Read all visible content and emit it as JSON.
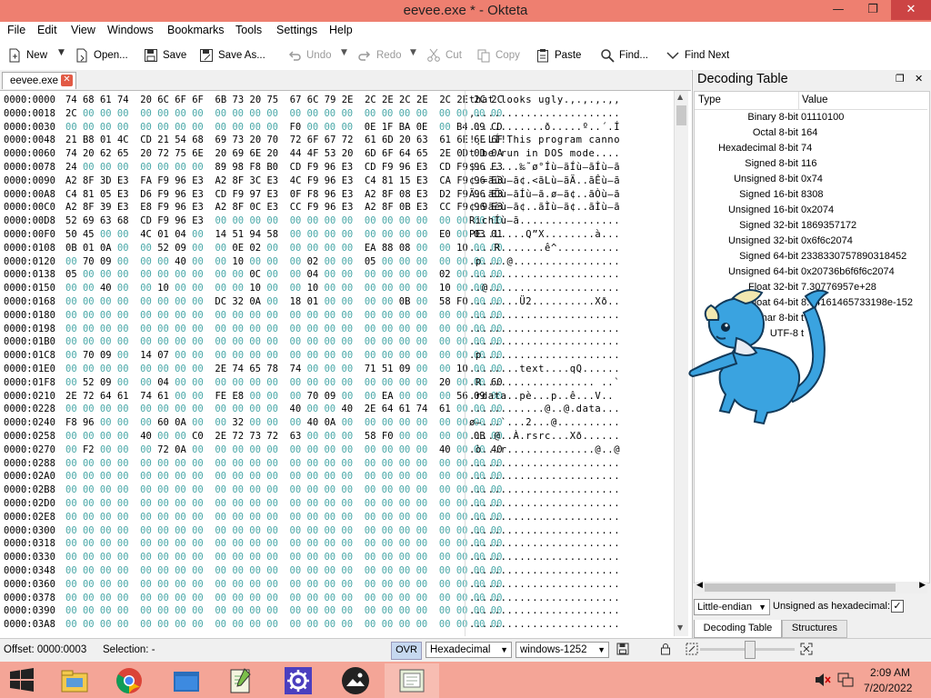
{
  "window": {
    "title": "eevee.exe * - Okteta"
  },
  "menu": [
    "File",
    "Edit",
    "View",
    "Windows",
    "Bookmarks",
    "Tools",
    "Settings",
    "Help"
  ],
  "toolbar": {
    "new": "New",
    "open": "Open...",
    "save": "Save",
    "save_as": "Save As...",
    "undo": "Undo",
    "redo": "Redo",
    "cut": "Cut",
    "copy": "Copy",
    "paste": "Paste",
    "find": "Find...",
    "find_next": "Find Next"
  },
  "tab": {
    "file": "eevee.exe"
  },
  "hex_rows": [
    {
      "o": "0000:0000",
      "h": "74 68 61 74  20 6C 6F 6F  6B 73 20 75  67 6C 79 2E  2C 2E 2C 2E  2C 2E 2C 2C",
      "c": "that looks ugly.,.,.,.,,"
    },
    {
      "o": "0000:0018",
      "h": "2C 00 00 00  00 00 00 00  00 00 00 00  00 00 00 00  00 00 00 00  00 00 00 00",
      "c": ",......................."
    },
    {
      "o": "0000:0030",
      "h": "00 00 00 00  00 00 00 00  00 00 00 00  F0 00 00 00  0E 1F BA 0E  00 B4 09 CD",
      "c": "............ð.....º..´.Í"
    },
    {
      "o": "0000:0048",
      "h": "21 B8 01 4C  CD 21 54 68  69 73 20 70  72 6F 67 72  61 6D 20 63  61 6E 6E 6F",
      "c": "!¸.LÍ!This program canno"
    },
    {
      "o": "0000:0060",
      "h": "74 20 62 65  20 72 75 6E  20 69 6E 20  44 4F 53 20  6D 6F 64 65  2E 0D 0D 0A",
      "c": "t be run in DOS mode...."
    },
    {
      "o": "0000:0078",
      "h": "24 00 00 00  00 00 00 00  89 98 F8 B0  CD F9 96 E3  CD F9 96 E3  CD F9 96 E3",
      "c": "$.......‰˜ø°Íù–ãÍù–ãÍù–ã"
    },
    {
      "o": "0000:0090",
      "h": "A2 8F 3D E3  FA F9 96 E3  A2 8F 3C E3  4C F9 96 E3  C4 81 15 E3  CA F9 96 E3",
      "c": "¢.=ãúù–ã¢.<ãLù–ãÄ..ãÊù–ã"
    },
    {
      "o": "0000:00A8",
      "h": "C4 81 05 E3  D6 F9 96 E3  CD F9 97 E3  0F F8 96 E3  A2 8F 08 E3  D2 F9 96 E3",
      "c": "Ä..ãÖù–ãÍù—ã.ø–ã¢..ãÒù–ã"
    },
    {
      "o": "0000:00C0",
      "h": "A2 8F 39 E3  E8 F9 96 E3  A2 8F 0C E3  CC F9 96 E3  A2 8F 0B E3  CC F9 96 E3",
      "c": "¢.9ãèù–ã¢..ãÌù–ã¢..ãÌù–ã"
    },
    {
      "o": "0000:00D8",
      "h": "52 69 63 68  CD F9 96 E3  00 00 00 00  00 00 00 00  00 00 00 00  00 00 00 00",
      "c": "RichÍù–ã................"
    },
    {
      "o": "0000:00F0",
      "h": "50 45 00 00  4C 01 04 00  14 51 94 58  00 00 00 00  00 00 00 00  E0 00 03 01",
      "c": "PE..L....Q”X........à..."
    },
    {
      "o": "0000:0108",
      "h": "0B 01 0A 00  00 52 09 00  00 0E 02 00  00 00 00 00  EA 88 08 00  00 10 00 00",
      "c": "....R.......ê^.........."
    },
    {
      "o": "0000:0120",
      "h": "00 70 09 00  00 00 40 00  00 10 00 00  00 02 00 00  05 00 00 00  00 00 00 00",
      "c": ".p....@................."
    },
    {
      "o": "0000:0138",
      "h": "05 00 00 00  00 00 00 00  00 00 0C 00  00 04 00 00  00 00 00 00  02 00 00 00",
      "c": "........................"
    },
    {
      "o": "0000:0150",
      "h": "00 00 40 00  00 10 00 00  00 00 10 00  00 10 00 00  00 00 00 00  10 00 00 00",
      "c": "..@....................."
    },
    {
      "o": "0000:0168",
      "h": "00 00 00 00  00 00 00 00  DC 32 0A 00  18 01 00 00  00 00 0B 00  58 F0 00 00",
      "c": "........Ü2..........Xð.."
    },
    {
      "o": "0000:0180",
      "h": "00 00 00 00  00 00 00 00  00 00 00 00  00 00 00 00  00 00 00 00  00 00 00 00",
      "c": "........................"
    },
    {
      "o": "0000:0198",
      "h": "00 00 00 00  00 00 00 00  00 00 00 00  00 00 00 00  00 00 00 00  00 00 00 00",
      "c": "........................"
    },
    {
      "o": "0000:01B0",
      "h": "00 00 00 00  00 00 00 00  00 00 00 00  00 00 00 00  00 00 00 00  00 00 00 00",
      "c": "........................"
    },
    {
      "o": "0000:01C8",
      "h": "00 70 09 00  14 07 00 00  00 00 00 00  00 00 00 00  00 00 00 00  00 00 00 00",
      "c": ".p......................"
    },
    {
      "o": "0000:01E0",
      "h": "00 00 00 00  00 00 00 00  2E 74 65 78  74 00 00 00  71 51 09 00  00 10 00 00",
      "c": "........text....qQ......"
    },
    {
      "o": "0000:01F8",
      "h": "00 52 09 00  00 04 00 00  00 00 00 00  00 00 00 00  00 00 00 00  20 00 00 60",
      "c": ".R.................. ..`"
    },
    {
      "o": "0000:0210",
      "h": "2E 72 64 61  74 61 00 00  FE E8 00 00  00 70 09 00  00 EA 00 00  00 56 09 00",
      "c": ".rdata..pè...p..ê...V.."
    },
    {
      "o": "0000:0228",
      "h": "00 00 00 00  00 00 00 00  00 00 00 00  40 00 00 40  2E 64 61 74  61 00 00 00",
      "c": "............@..@.data..."
    },
    {
      "o": "0000:0240",
      "h": "F8 96 00 00  00 60 0A 00  00 32 00 00  00 40 0A 00  00 00 00 00  00 00 00 00",
      "c": "ø–...`...2...@.........."
    },
    {
      "o": "0000:0258",
      "h": "00 00 00 00  40 00 00 C0  2E 72 73 72  63 00 00 00  58 F0 00 00  00 00 0B 00",
      "c": "....@..À.rsrc...Xð......"
    },
    {
      "o": "0000:0270",
      "h": "00 F2 00 00  00 72 0A 00  00 00 00 00  00 00 00 00  00 00 00 00  40 00 00 40",
      "c": ".ò...r..............@..@"
    },
    {
      "o": "0000:0288",
      "h": "00 00 00 00  00 00 00 00  00 00 00 00  00 00 00 00  00 00 00 00  00 00 00 00",
      "c": "........................"
    },
    {
      "o": "0000:02A0",
      "h": "00 00 00 00  00 00 00 00  00 00 00 00  00 00 00 00  00 00 00 00  00 00 00 00",
      "c": "........................"
    },
    {
      "o": "0000:02B8",
      "h": "00 00 00 00  00 00 00 00  00 00 00 00  00 00 00 00  00 00 00 00  00 00 00 00",
      "c": "........................"
    },
    {
      "o": "0000:02D0",
      "h": "00 00 00 00  00 00 00 00  00 00 00 00  00 00 00 00  00 00 00 00  00 00 00 00",
      "c": "........................"
    },
    {
      "o": "0000:02E8",
      "h": "00 00 00 00  00 00 00 00  00 00 00 00  00 00 00 00  00 00 00 00  00 00 00 00",
      "c": "........................"
    },
    {
      "o": "0000:0300",
      "h": "00 00 00 00  00 00 00 00  00 00 00 00  00 00 00 00  00 00 00 00  00 00 00 00",
      "c": "........................"
    },
    {
      "o": "0000:0318",
      "h": "00 00 00 00  00 00 00 00  00 00 00 00  00 00 00 00  00 00 00 00  00 00 00 00",
      "c": "........................"
    },
    {
      "o": "0000:0330",
      "h": "00 00 00 00  00 00 00 00  00 00 00 00  00 00 00 00  00 00 00 00  00 00 00 00",
      "c": "........................"
    },
    {
      "o": "0000:0348",
      "h": "00 00 00 00  00 00 00 00  00 00 00 00  00 00 00 00  00 00 00 00  00 00 00 00",
      "c": "........................"
    },
    {
      "o": "0000:0360",
      "h": "00 00 00 00  00 00 00 00  00 00 00 00  00 00 00 00  00 00 00 00  00 00 00 00",
      "c": "........................"
    },
    {
      "o": "0000:0378",
      "h": "00 00 00 00  00 00 00 00  00 00 00 00  00 00 00 00  00 00 00 00  00 00 00 00",
      "c": "........................"
    },
    {
      "o": "0000:0390",
      "h": "00 00 00 00  00 00 00 00  00 00 00 00  00 00 00 00  00 00 00 00  00 00 00 00",
      "c": "........................"
    },
    {
      "o": "0000:03A8",
      "h": "00 00 00 00  00 00 00 00  00 00 00 00  00 00 00 00  00 00 00 00  00 00 00 00",
      "c": "........................"
    }
  ],
  "decoding": {
    "title": "Decoding Table",
    "col_type": "Type",
    "col_value": "Value",
    "rows": [
      {
        "type": "Binary 8-bit",
        "value": "01110100"
      },
      {
        "type": "Octal 8-bit",
        "value": "164"
      },
      {
        "type": "Hexadecimal 8-bit",
        "value": "74"
      },
      {
        "type": "Signed 8-bit",
        "value": "116"
      },
      {
        "type": "Unsigned 8-bit",
        "value": "0x74"
      },
      {
        "type": "Signed 16-bit",
        "value": "8308"
      },
      {
        "type": "Unsigned 16-bit",
        "value": "0x2074"
      },
      {
        "type": "Signed 32-bit",
        "value": "1869357172"
      },
      {
        "type": "Unsigned 32-bit",
        "value": "0x6f6c2074"
      },
      {
        "type": "Signed 64-bit",
        "value": "2338330757890318452"
      },
      {
        "type": "Unsigned 64-bit",
        "value": "0x20736b6f6f6c2074"
      },
      {
        "type": "Float 32-bit",
        "value": "7.30776957e+28"
      },
      {
        "type": "Float 64-bit",
        "value": "8.34161465733198e-152"
      },
      {
        "type": "Char 8-bit",
        "value": "t"
      },
      {
        "type": "UTF-8",
        "value": "t"
      }
    ],
    "endianness": "Little-endian",
    "unsigned_label": "Unsigned as hexadecimal:",
    "unsigned_checked": "✓",
    "tab_decoding": "Decoding Table",
    "tab_structures": "Structures"
  },
  "status": {
    "offset": "Offset: 0000:0003",
    "selection": "Selection: -",
    "ovr": "OVR",
    "encoding": "Hexadecimal",
    "charset": "windows-1252"
  },
  "taskbar": {
    "time": "2:09 AM",
    "date": "7/20/2022",
    "apps": [
      "file-explorer",
      "chrome",
      "folder",
      "notepad-plus",
      "settings",
      "photos",
      "okteta"
    ]
  },
  "colors": {
    "titlebar": "#ee7f70",
    "taskbar": "#f4a597",
    "hex_zero": "#4aa8a8"
  }
}
